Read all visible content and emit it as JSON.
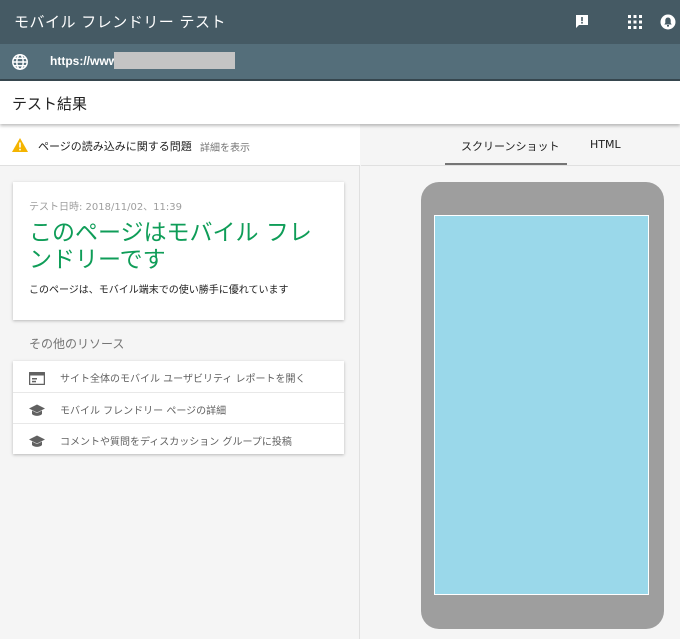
{
  "app": {
    "title": "モバイル フレンドリー テスト",
    "header_icons": [
      "feedback-icon",
      "apps-grid-icon",
      "account-icon"
    ]
  },
  "url_bar": {
    "icon": "globe-icon",
    "url_prefix": "https://www."
  },
  "results": {
    "title": "テスト結果"
  },
  "issues": {
    "icon": "warning-icon",
    "text": "ページの読み込みに関する問題",
    "link": "詳細を表示"
  },
  "result_card": {
    "date": "テスト日時: 2018/11/02、11:39",
    "headline": "このページはモバイル フレンドリーです",
    "description": "このページは、モバイル端末での使い勝手に優れています"
  },
  "resources": {
    "title": "その他のリソース",
    "items": [
      {
        "icon": "report-icon",
        "label": "サイト全体のモバイル ユーザビリティ レポートを開く"
      },
      {
        "icon": "school-icon",
        "label": "モバイル フレンドリー ページの詳細"
      },
      {
        "icon": "school-icon",
        "label": "コメントや質問をディスカッション グループに投稿"
      }
    ]
  },
  "tabs": [
    {
      "label": "スクリーンショット",
      "active": true
    },
    {
      "label": "HTML",
      "active": false
    }
  ],
  "colors": {
    "topbar": "#455a64",
    "urlbar": "#546e7a",
    "success_green": "#0f9d58",
    "warning_yellow": "#f4b400",
    "phone_frame": "#9e9e9e",
    "screen_preview": "#9ad8ea"
  }
}
